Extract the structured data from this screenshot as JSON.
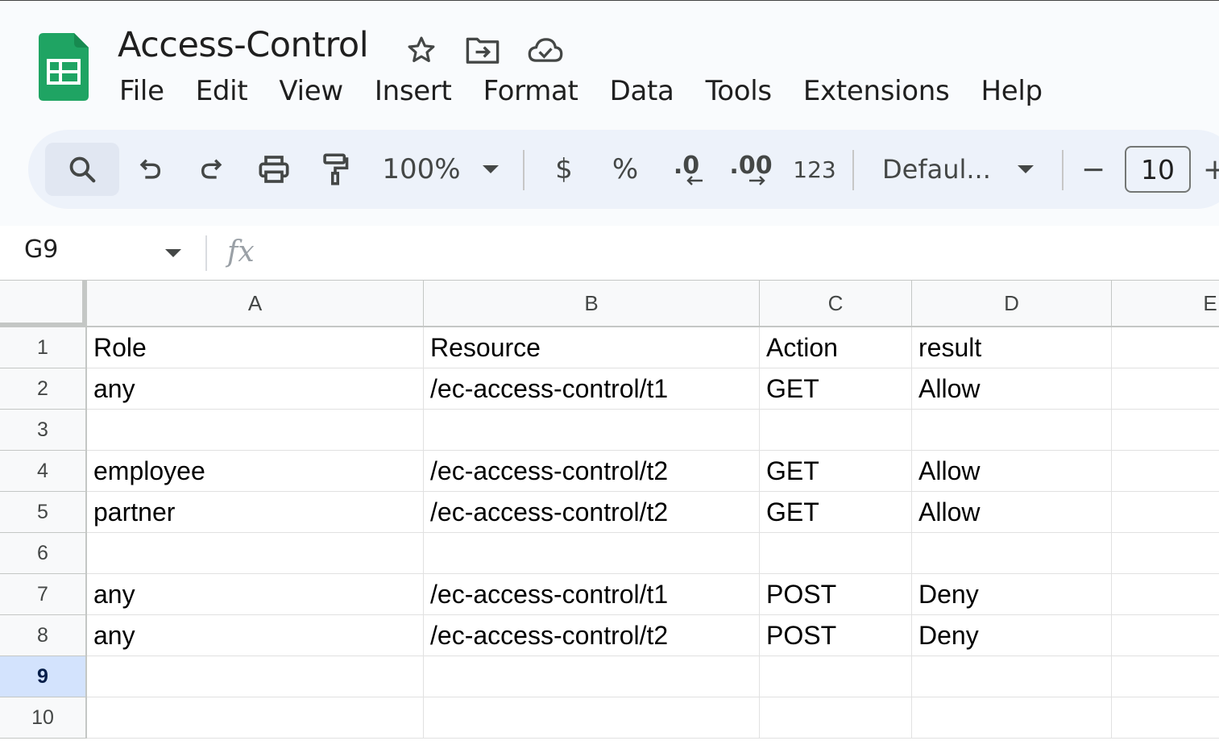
{
  "doc": {
    "title": "Access-Control"
  },
  "menu": [
    "File",
    "Edit",
    "View",
    "Insert",
    "Format",
    "Data",
    "Tools",
    "Extensions",
    "Help"
  ],
  "toolbar": {
    "zoom": "100%",
    "currency": "$",
    "percent": "%",
    "decrease_decimal": ".0",
    "increase_decimal": ".00",
    "number_format": "123",
    "font": "Defaul...",
    "font_size": "10",
    "font_size_minus": "−",
    "font_size_plus": "+"
  },
  "formula_bar": {
    "cell_ref": "G9",
    "fx": "fx",
    "value": ""
  },
  "columns": [
    "A",
    "B",
    "C",
    "D",
    "E"
  ],
  "rows": [
    {
      "num": "1",
      "cells": [
        "Role",
        "Resource",
        "Action",
        "result",
        ""
      ]
    },
    {
      "num": "2",
      "cells": [
        "any",
        "/ec-access-control/t1",
        "GET",
        "Allow",
        ""
      ]
    },
    {
      "num": "3",
      "cells": [
        "",
        "",
        "",
        "",
        ""
      ]
    },
    {
      "num": "4",
      "cells": [
        "employee",
        "/ec-access-control/t2",
        "GET",
        "Allow",
        ""
      ]
    },
    {
      "num": "5",
      "cells": [
        "partner",
        "/ec-access-control/t2",
        "GET",
        "Allow",
        ""
      ]
    },
    {
      "num": "6",
      "cells": [
        "",
        "",
        "",
        "",
        ""
      ]
    },
    {
      "num": "7",
      "cells": [
        "any",
        "/ec-access-control/t1",
        "POST",
        "Deny",
        ""
      ]
    },
    {
      "num": "8",
      "cells": [
        "any",
        "/ec-access-control/t2",
        "POST",
        "Deny",
        ""
      ]
    },
    {
      "num": "9",
      "cells": [
        "",
        "",
        "",
        "",
        ""
      ]
    },
    {
      "num": "10",
      "cells": [
        "",
        "",
        "",
        "",
        ""
      ]
    }
  ],
  "selected_row": "9",
  "colors": {
    "header_bg": "#f9fbfd",
    "toolbar_bg": "#edf2fa",
    "logo_green": "#1fa463",
    "selected_row_bg": "#d3e3fd"
  }
}
